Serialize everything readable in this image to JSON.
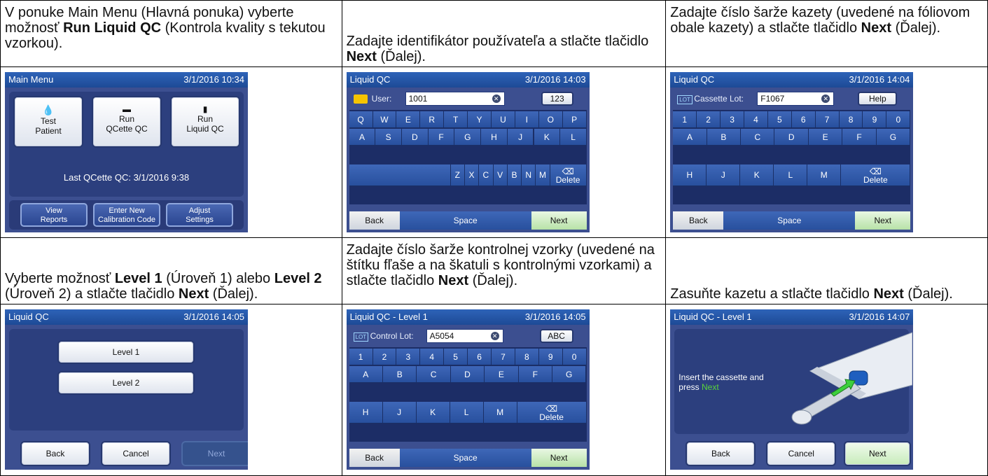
{
  "instructions": {
    "c1": {
      "pre": "V ponuke Main Menu (Hlavná ponuka) vyberte možnosť ",
      "bold": "Run Liquid QC",
      "post": " (Kontrola kvality s tekutou vzorkou)."
    },
    "c2": {
      "pre": "Zadajte identifikátor používateľa a stlačte tlačidlo ",
      "bold": "Next",
      "post": " (Ďalej)."
    },
    "c3": {
      "pre": "Zadajte číslo šarže kazety (uvedené na fóliovom obale kazety) a stlačte tlačidlo ",
      "bold": "Next",
      "post": " (Ďalej)."
    },
    "c4": {
      "pre": "Vyberte možnosť ",
      "bold1": "Level 1",
      "mid": " (Úroveň 1) alebo ",
      "bold2": "Level 2",
      "mid2": " (Úroveň 2) a stlačte tlačidlo ",
      "bold3": "Next",
      "post": " (Ďalej)."
    },
    "c5": {
      "pre": "Zadajte číslo šarže kontrolnej vzorky (uvedené na štítku fľaše a na škatuli s kontrolnými vzorkami) a stlačte tlačidlo ",
      "bold": "Next",
      "post": " (Ďalej)."
    },
    "c6": {
      "pre": "Zasuňte kazetu a stlačte tlačidlo ",
      "bold": "Next",
      "post": " (Ďalej)."
    }
  },
  "screen1": {
    "title": "Main Menu",
    "datetime": "3/1/2016 10:34",
    "btn1": [
      "Test",
      "Patient"
    ],
    "btn2": [
      "Run",
      "QCette QC"
    ],
    "btn3": [
      "Run",
      "Liquid QC"
    ],
    "last": "Last QCette QC: 3/1/2016 9:38",
    "nav1": [
      "View",
      "Reports"
    ],
    "nav2": [
      "Enter New",
      "Calibration Code"
    ],
    "nav3": [
      "Adjust",
      "Settings"
    ]
  },
  "screen2": {
    "title": "Liquid QC",
    "datetime": "3/1/2016 14:03",
    "label": "User:",
    "value": "1001",
    "mode": "123",
    "row1": [
      "Q",
      "W",
      "E",
      "R",
      "T",
      "Y",
      "U",
      "I",
      "O",
      "P"
    ],
    "row2": [
      "A",
      "S",
      "D",
      "F",
      "G",
      "H",
      "J",
      "K",
      "L"
    ],
    "row3": [
      "Z",
      "X",
      "C",
      "V",
      "B",
      "N",
      "M"
    ],
    "delete": "Delete",
    "back": "Back",
    "space": "Space",
    "next": "Next"
  },
  "screen3": {
    "title": "Liquid QC",
    "datetime": "3/1/2016 14:04",
    "badge": "LOT",
    "label": "Cassette Lot:",
    "value": "F1067",
    "help": "Help",
    "row1": [
      "1",
      "2",
      "3",
      "4",
      "5",
      "6",
      "7",
      "8",
      "9",
      "0"
    ],
    "row2": [
      "A",
      "B",
      "C",
      "D",
      "E",
      "F",
      "G"
    ],
    "row3": [
      "H",
      "J",
      "K",
      "L",
      "M"
    ],
    "delete": "Delete",
    "back": "Back",
    "space": "Space",
    "next": "Next"
  },
  "screen4": {
    "title": "Liquid QC",
    "datetime": "3/1/2016 14:05",
    "level1": "Level 1",
    "level2": "Level 2",
    "back": "Back",
    "cancel": "Cancel",
    "next": "Next"
  },
  "screen5": {
    "title": "Liquid QC - Level 1",
    "datetime": "3/1/2016 14:05",
    "badge": "LOT",
    "label": "Control Lot:",
    "value": "A5054",
    "mode": "ABC",
    "row1": [
      "1",
      "2",
      "3",
      "4",
      "5",
      "6",
      "7",
      "8",
      "9",
      "0"
    ],
    "row2": [
      "A",
      "B",
      "C",
      "D",
      "E",
      "F",
      "G"
    ],
    "row3": [
      "H",
      "J",
      "K",
      "L",
      "M"
    ],
    "delete": "Delete",
    "back": "Back",
    "space": "Space",
    "next": "Next"
  },
  "screen6": {
    "title": "Liquid QC - Level 1",
    "datetime": "3/1/2016 14:07",
    "msg1": "Insert the cassette and",
    "msg2": "press",
    "msg_next": "Next",
    "back": "Back",
    "cancel": "Cancel",
    "next": "Next"
  },
  "colors": {
    "screen_bg": "#3c4f90",
    "title_bar": "#1d4a96",
    "key": "#3e67b8",
    "next_green": "#b7e2a7",
    "green_text": "#59d43b"
  }
}
